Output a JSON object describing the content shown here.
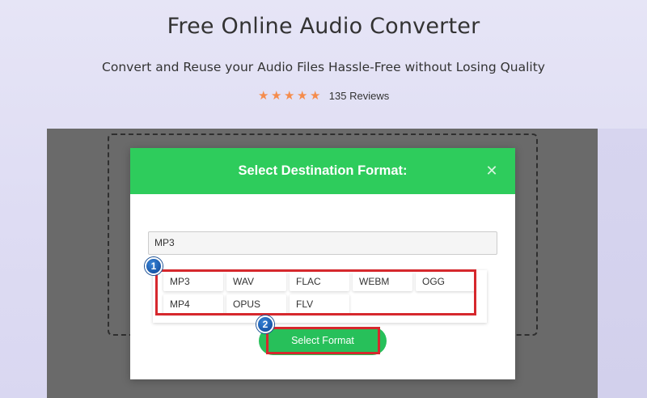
{
  "header": {
    "title": "Free Online Audio Converter",
    "subtitle": "Convert and Reuse your Audio Files Hassle-Free without Losing Quality",
    "rating": {
      "stars": 5,
      "max_stars": 5,
      "star_color": "#f58c4c",
      "reviews_label": "135 Reviews"
    }
  },
  "modal": {
    "title": "Select Destination Format:",
    "close_icon": "close-icon",
    "header_color": "#2ecc5c",
    "selected_format": "MP3",
    "formats": [
      "MP3",
      "WAV",
      "FLAC",
      "WEBM",
      "OGG",
      "MP4",
      "OPUS",
      "FLV"
    ],
    "select_button_label": "Select Format",
    "button_color": "#27c05a"
  },
  "annotations": {
    "step1": "1",
    "step2": "2",
    "highlight_color": "#d6282d",
    "badge_color": "#1756a8"
  }
}
